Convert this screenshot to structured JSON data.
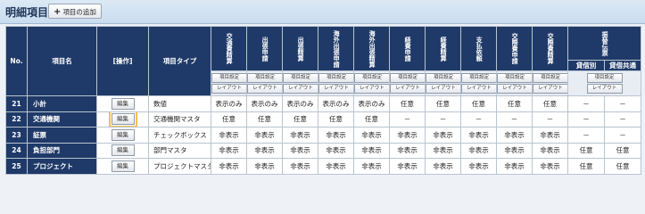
{
  "header": {
    "title": "明細項目",
    "add_button": "項目の追加"
  },
  "columns": {
    "no": "No.",
    "name": "項目名",
    "action": "[操作]",
    "type": "項目タイプ",
    "forms": [
      "交通費精算",
      "出張申請",
      "出張精算",
      "海外出張申請",
      "海外出張精算",
      "経費申請",
      "経費精算",
      "支払依頼",
      "交際費申請",
      "交際費精算"
    ],
    "voucher_group": "振替伝票",
    "voucher_sub": [
      "貸借別",
      "貸借共通"
    ],
    "btn_setting": "項目設定",
    "btn_layout": "レイアウト"
  },
  "rows": [
    {
      "no": "21",
      "name": "小計",
      "edit": "編集",
      "type": "数値",
      "cells": [
        "表示のみ",
        "表示のみ",
        "表示のみ",
        "表示のみ",
        "表示のみ",
        "任意",
        "任意",
        "任意",
        "任意",
        "任意",
        "－",
        "－"
      ]
    },
    {
      "no": "22",
      "name": "交通機関",
      "edit": "編集",
      "type": "交通機関マスタ",
      "cells": [
        "任意",
        "任意",
        "任意",
        "任意",
        "任意",
        "－",
        "－",
        "－",
        "－",
        "－",
        "－",
        "－"
      ]
    },
    {
      "no": "23",
      "name": "証票",
      "edit": "編集",
      "type": "チェックボックス",
      "cells": [
        "非表示",
        "非表示",
        "非表示",
        "非表示",
        "非表示",
        "非表示",
        "非表示",
        "非表示",
        "非表示",
        "非表示",
        "－",
        "－"
      ]
    },
    {
      "no": "24",
      "name": "負担部門",
      "edit": "編集",
      "type": "部門マスタ",
      "cells": [
        "非表示",
        "非表示",
        "非表示",
        "非表示",
        "非表示",
        "非表示",
        "非表示",
        "非表示",
        "非表示",
        "非表示",
        "任意",
        "任意"
      ]
    },
    {
      "no": "25",
      "name": "プロジェクト",
      "edit": "編集",
      "type": "プロジェクトマスタ",
      "cells": [
        "非表示",
        "非表示",
        "非表示",
        "非表示",
        "非表示",
        "非表示",
        "非表示",
        "非表示",
        "非表示",
        "非表示",
        "任意",
        "任意"
      ]
    }
  ]
}
